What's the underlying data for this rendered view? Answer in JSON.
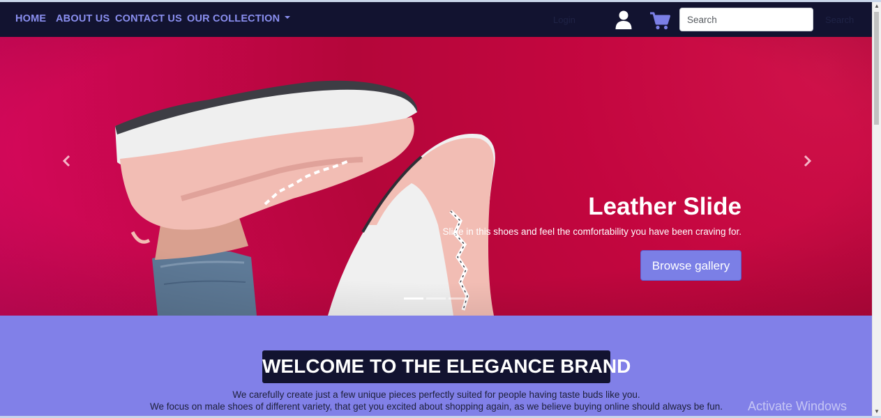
{
  "nav": {
    "home": "HOME",
    "about": "ABOUT US",
    "contact": "CONTACT US",
    "collection": "OUR COLLECTION",
    "login": "Login",
    "search_placeholder": "Search",
    "search_button": "Search",
    "user_icon": "user-icon",
    "cart_icon": "shopping-cart-icon"
  },
  "carousel": {
    "caption_title": "Leather Slide",
    "caption_text": "Slide in this shoes and feel the comfortability you have been craving for.",
    "button": "Browse gallery",
    "slides": 3,
    "active_slide": 1
  },
  "welcome": {
    "title": "WELCOME TO THE ELEGANCE BRAND",
    "line1": "We carefully create just a few unique pieces perfectly suited for people having taste buds like you.",
    "line2": "We focus on male shoes of different variety, that get you excited about shopping again, as we believe buying online should always be fun."
  },
  "watermark": "Activate Windows",
  "colors": {
    "navbar": "#121330",
    "nav_link": "#8a8ff0",
    "hero_bg": "#c3063f",
    "accent": "#7b7fe6",
    "welcome_bg": "#8180e8"
  }
}
